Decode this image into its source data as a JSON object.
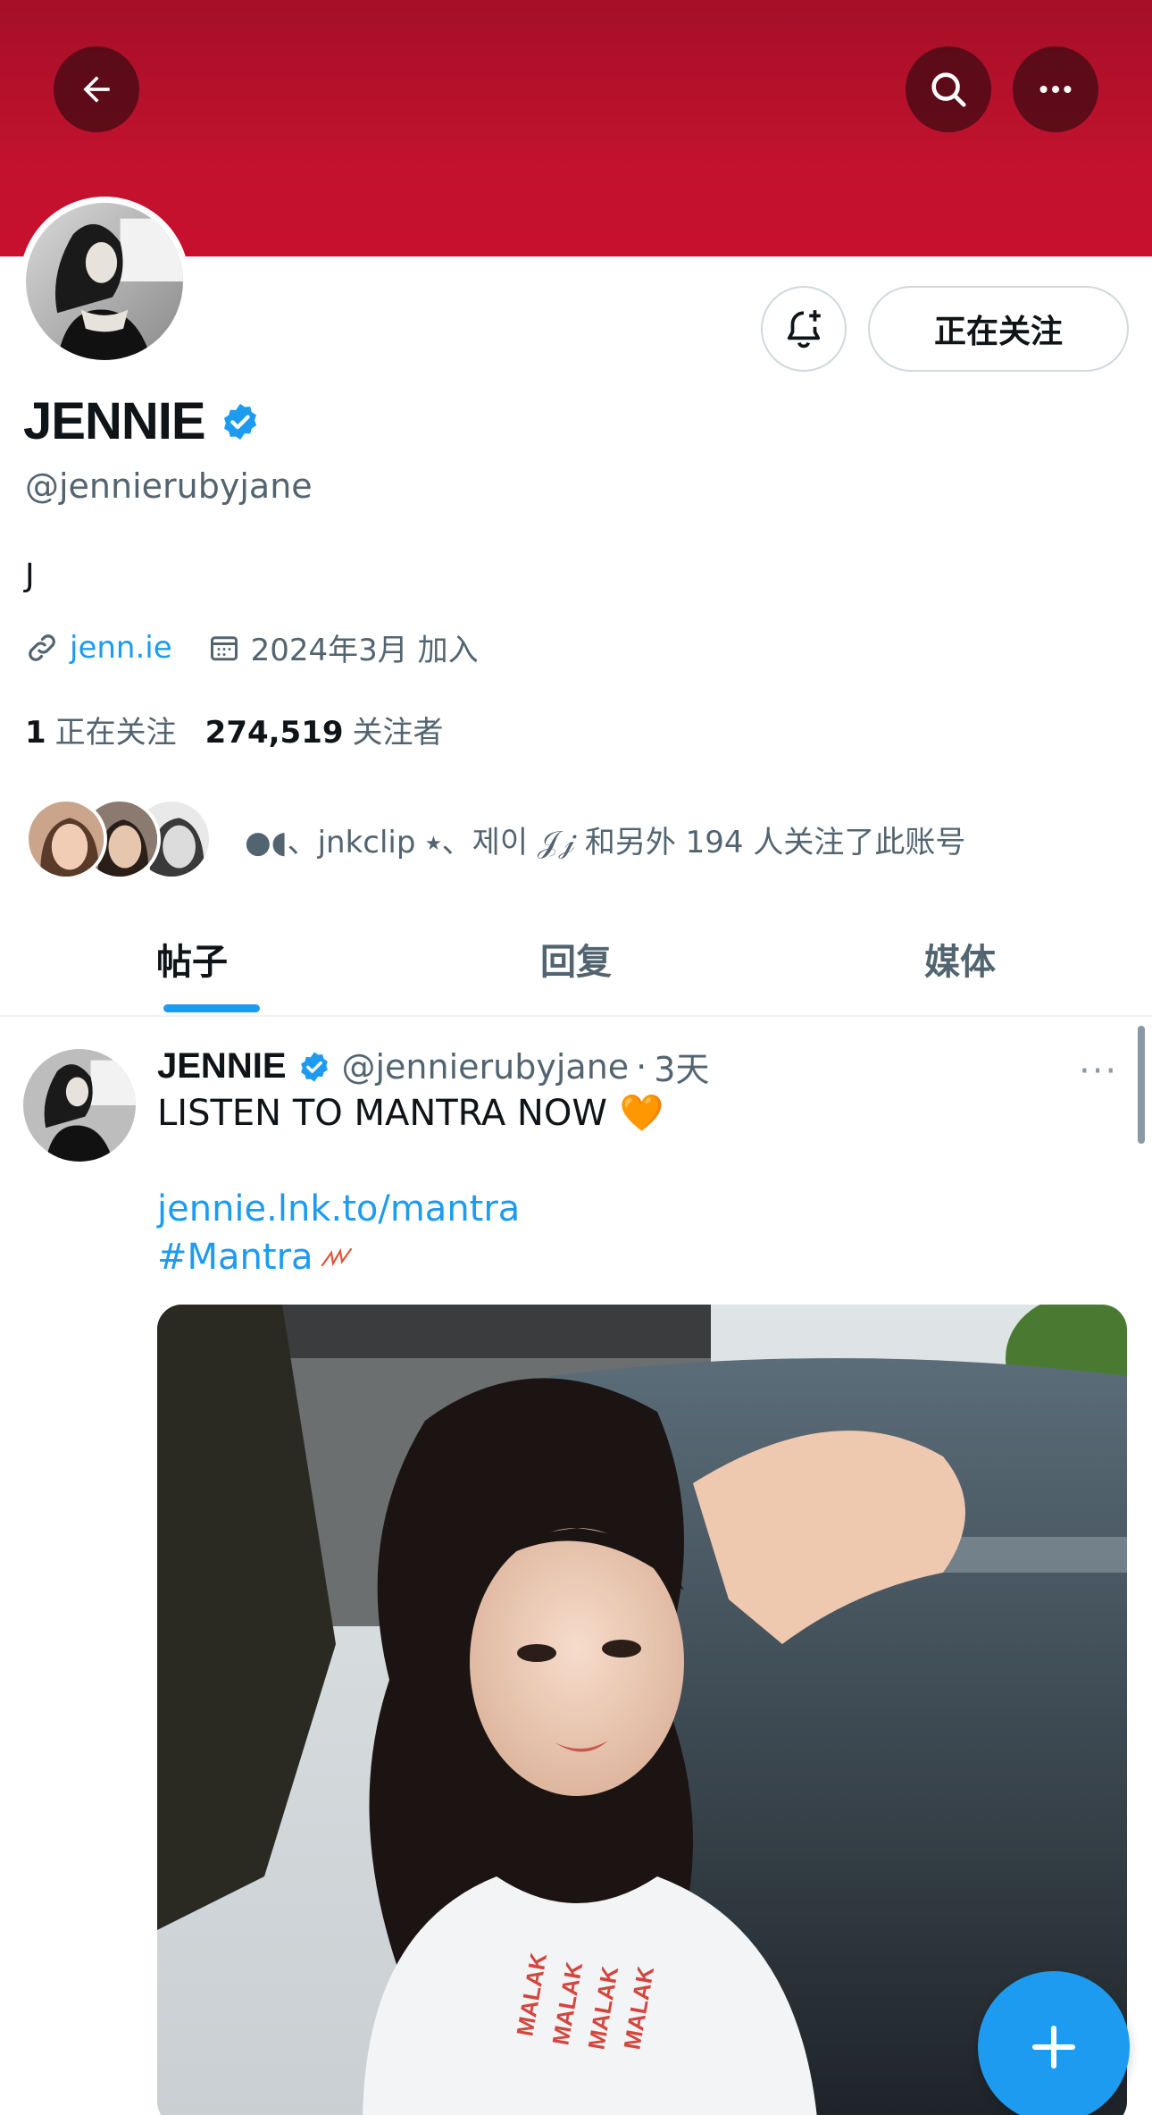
{
  "header": {
    "back_icon": "arrow-left-icon",
    "search_icon": "search-icon",
    "more_icon": "more-horizontal-icon",
    "banner_color": "#c0122e"
  },
  "profile": {
    "display_name": "JENNIE",
    "verified": true,
    "handle": "@jennierubyjane",
    "bio": "J",
    "link": "jenn.ie",
    "joined": "2024年3月 加入",
    "following_count": "1",
    "following_label": "正在关注",
    "followers_count": "274,519",
    "followers_label": "关注者",
    "followers_you_know": "●◖、jnkclip ⭑、제이 𝒥𝒿 和另外 194 人关注了此账号"
  },
  "actions": {
    "notify_icon": "bell-plus-icon",
    "following_button": "正在关注"
  },
  "tabs": [
    {
      "label": "帖子",
      "active": true
    },
    {
      "label": "回复",
      "active": false
    },
    {
      "label": "媒体",
      "active": false
    }
  ],
  "tweet": {
    "name": "JENNIE",
    "handle": "@jennierubyjane",
    "separator": "·",
    "time": "3天",
    "text": "LISTEN TO MANTRA NOW",
    "emoji": "🧡",
    "link": "jennie.lnk.to/mantra",
    "hashtag": "#Mantra",
    "more": "···"
  },
  "fab": {
    "icon": "plus-icon"
  },
  "colors": {
    "accent": "#1d9bf0",
    "text": "#0f1419",
    "muted": "#536471"
  }
}
